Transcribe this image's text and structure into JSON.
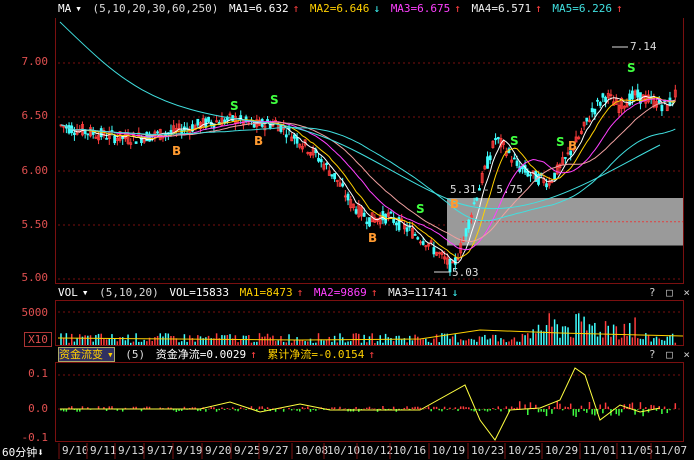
{
  "main": {
    "indicator_label": "MA",
    "params": "(5,10,20,30,60,250)",
    "ma": [
      {
        "label": "MA1=6.632",
        "color": "#ffffff"
      },
      {
        "label": "MA2=6.646",
        "color": "#ffd000"
      },
      {
        "label": "MA3=6.675",
        "color": "#ff40ff"
      },
      {
        "label": "MA4=6.571",
        "color": "#f0f0f0"
      },
      {
        "label": "MA5=6.226",
        "color": "#40e0e0"
      }
    ],
    "y_ticks": [
      "7.00",
      "6.50",
      "6.00",
      "5.50",
      "5.00"
    ],
    "annotations": {
      "high": "7.14",
      "low": "5.03",
      "range": "5.31 - 5.75"
    },
    "b_label": "B",
    "s_label": "S",
    "controls": "? □ ×"
  },
  "volume": {
    "indicator_label": "VOL",
    "params": "(5,10,20)",
    "values": [
      {
        "label": "VOL=15833",
        "color": "#ffffff"
      },
      {
        "label": "MA1=8473",
        "color": "#ffd000"
      },
      {
        "label": "MA2=9869",
        "color": "#ff40ff"
      },
      {
        "label": "MA3=11741",
        "color": "#f0f0f0"
      }
    ],
    "y_ticks": [
      "5000",
      "X10"
    ],
    "controls": "? □ ×"
  },
  "fund": {
    "indicator_label": "资金流变",
    "params": "(5)",
    "values": [
      {
        "label": "资金净流=0.0029",
        "color": "#ffffff"
      },
      {
        "label": "累计净流=-0.0154",
        "color": "#ffd000"
      }
    ],
    "y_ticks": [
      "0.1",
      "0.0",
      "-0.1"
    ],
    "controls": "? □ ×"
  },
  "xaxis": {
    "period": "60分钟",
    "dates": [
      "9/10",
      "9/11",
      "9/13",
      "9/17",
      "9/19",
      "9/20",
      "9/25",
      "9/27",
      "10/08",
      "10/10",
      "10/12",
      "10/16",
      "10/19",
      "10/23",
      "10/25",
      "10/29",
      "11/01",
      "11/05",
      "11/07"
    ]
  },
  "colors": {
    "up": "#ff3c3c",
    "down": "#40ffff",
    "grid": "#7a1010",
    "bg": "#000000"
  }
}
